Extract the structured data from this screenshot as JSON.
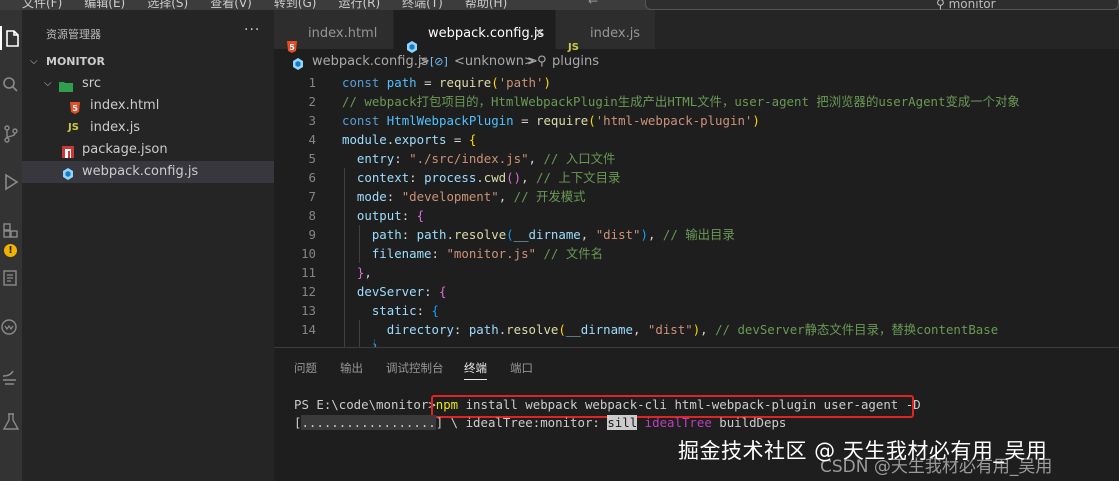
{
  "titlebar": {
    "menu": [
      "文件(F)",
      "编辑(E)",
      "选择(S)",
      "查看(V)",
      "转到(G)",
      "运行(R)",
      "终端(T)",
      "帮助(H)"
    ],
    "search_text": "monitor"
  },
  "sidebar": {
    "title": "资源管理器",
    "more": "···",
    "root": "MONITOR",
    "items": [
      {
        "label": "src",
        "kind": "folder"
      },
      {
        "label": "index.html",
        "kind": "html"
      },
      {
        "label": "index.js",
        "kind": "js"
      },
      {
        "label": "package.json",
        "kind": "npm"
      },
      {
        "label": "webpack.config.js",
        "kind": "webpack",
        "selected": true
      }
    ]
  },
  "editor": {
    "tabs": [
      {
        "label": "index.html",
        "icon": "html-icon"
      },
      {
        "label": "webpack.config.js",
        "icon": "webpack-icon",
        "active": true,
        "close": "×"
      },
      {
        "label": "index.js",
        "icon": "js-icon"
      }
    ],
    "breadcrumb": {
      "file": "webpack.config.js",
      "sep": ">",
      "symbol": "<unknown>",
      "property": "plugins"
    },
    "line_numbers": [
      "1",
      "2",
      "3",
      "4",
      "5",
      "6",
      "7",
      "8",
      "9",
      "10",
      "11",
      "12",
      "13",
      "14"
    ]
  },
  "panel": {
    "tabs": [
      "问题",
      "输出",
      "调试控制台",
      "终端",
      "端口"
    ],
    "active_tab": "终端",
    "terminal": {
      "prompt": "PS E:\\code\\monitor>",
      "cmd_word": "npm",
      "cmd_args": " install webpack webpack-cli html-webpack-plugin user-agent -D",
      "progress_bracket_open": "[",
      "progress_dots": "..................",
      "progress_bracket_close": "]",
      "progress_rest": " \\ idealTree:monitor: ",
      "level": "sill",
      "stage": " idealTree",
      "tail": " buildDeps"
    }
  },
  "watermark": {
    "title": "掘金技术社区 @ 天生我材必有用_吴用",
    "sub": "CSDN @天生我材必有用_吴用"
  },
  "colors": {
    "keyword": "#569cd6",
    "variable": "#4fc1ff",
    "property": "#9cdcfe",
    "function": "#dcdcaa",
    "string": "#ce9178",
    "comment": "#6a9955",
    "highlight_box": "#e02424"
  }
}
